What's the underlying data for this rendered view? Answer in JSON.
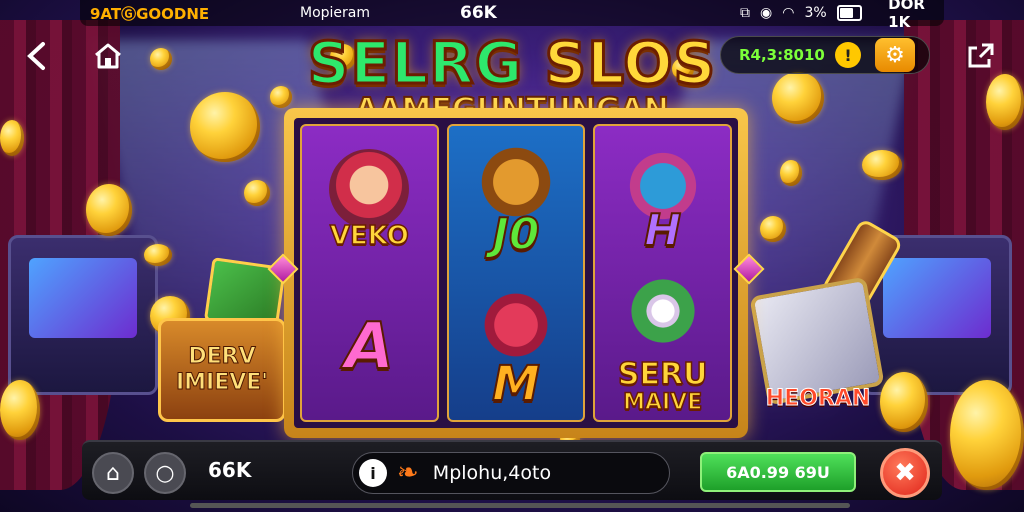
{
  "status_bar": {
    "brand": "9ATⒼGOODNE",
    "center_label": "Mopieram",
    "count": "66K",
    "battery_text": "3%",
    "battery_level": 0.45,
    "right_text": "DOR 1K"
  },
  "nav": {
    "back_icon": "chevron-left-icon",
    "home_icon": "home-icon",
    "share_icon": "share-icon"
  },
  "balance": {
    "amount": "R4,3:8010",
    "warning_glyph": "!",
    "settings_icon": "gear-icon"
  },
  "title": {
    "main_a": "SELRG",
    "main_b": "SLOS",
    "sub": "AAMEGUNTUNGAN"
  },
  "reels": [
    {
      "top_label": "VEKO",
      "bottom_letter": "A"
    },
    {
      "top_label": "J0",
      "bottom_letter": "M"
    },
    {
      "top_label": "H",
      "bottom_line1": "SERU",
      "bottom_line2": "MAIVE"
    }
  ],
  "props": {
    "chest_line1": "DERV",
    "chest_line2": "IMIEVE'",
    "badge_name": "HEORAN"
  },
  "bottom_bar": {
    "credit": "66K",
    "info_glyph": "i",
    "message": "Mplohu,4oto",
    "spin_label": "6A0.99 69U",
    "stop_glyph": "✖"
  },
  "colors": {
    "accent_gold": "#ffd83a",
    "spin_green": "#1ea02a",
    "stop_red": "#e0241a",
    "balance_green": "#7cff3a"
  }
}
